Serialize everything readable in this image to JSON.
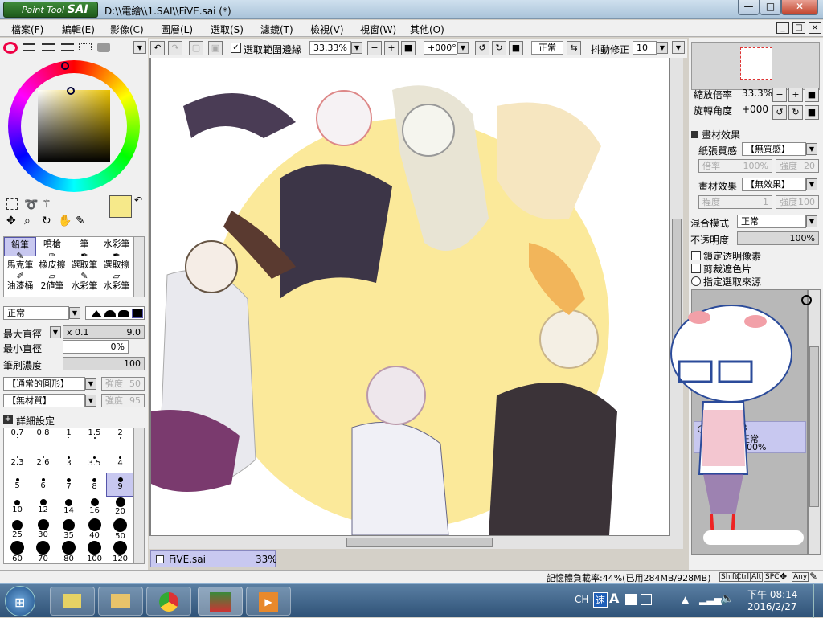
{
  "titlebar": {
    "logo_small": "Paint Tool",
    "logo_big": "SAI",
    "title": "D:\\\\電繪\\\\1.SAI\\\\FiVE.sai (*)",
    "btn_min": "—",
    "btn_max": "□",
    "btn_close": "✕"
  },
  "menu": [
    "檔案(F)",
    "編輯(E)",
    "影像(C)",
    "圖層(L)",
    "選取(S)",
    "濾鏡(T)",
    "檢視(V)",
    "視窗(W)",
    "其他(O)"
  ],
  "toolbar": {
    "selection_edge_label": "選取範圍邊緣",
    "zoom": "33.33%",
    "rotation": "+000°",
    "mode": "正常",
    "stabilizer_label": "抖動修正",
    "stabilizer_value": "10"
  },
  "tools": {
    "row1": [
      "鉛筆",
      "噴槍",
      "筆",
      "水彩筆"
    ],
    "row2": [
      "馬克筆",
      "橡皮擦",
      "選取筆",
      "選取擦"
    ],
    "row3": [
      "油漆桶",
      "2値筆",
      "水彩筆",
      "水彩筆"
    ]
  },
  "brush": {
    "blend": "正常",
    "max_size_label": "最大直徑",
    "max_size_mult": "x 0.1",
    "max_size_val": "9.0",
    "min_size_label": "最小直徑",
    "min_size_val": "0%",
    "density_label": "筆刷濃度",
    "density_val": "100",
    "shape": "【通常的圓形】",
    "shape_strength_label": "強度",
    "shape_strength": "50",
    "texture": "【無材質】",
    "texture_strength_label": "強度",
    "texture_strength": "95",
    "details": "詳細設定"
  },
  "brush_sizes": [
    {
      "l": "0.7",
      "d": 1
    },
    {
      "l": "0.8",
      "d": 1
    },
    {
      "l": "1",
      "d": 1
    },
    {
      "l": "1.5",
      "d": 2
    },
    {
      "l": "2",
      "d": 2
    },
    {
      "l": "2.3",
      "d": 2
    },
    {
      "l": "2.6",
      "d": 2
    },
    {
      "l": "3",
      "d": 3
    },
    {
      "l": "3.5",
      "d": 3
    },
    {
      "l": "4",
      "d": 3
    },
    {
      "l": "5",
      "d": 4
    },
    {
      "l": "6",
      "d": 4
    },
    {
      "l": "7",
      "d": 5
    },
    {
      "l": "8",
      "d": 5
    },
    {
      "l": "9",
      "d": 6
    },
    {
      "l": "10",
      "d": 7
    },
    {
      "l": "12",
      "d": 8
    },
    {
      "l": "14",
      "d": 9
    },
    {
      "l": "16",
      "d": 10
    },
    {
      "l": "20",
      "d": 12
    },
    {
      "l": "25",
      "d": 13
    },
    {
      "l": "30",
      "d": 14
    },
    {
      "l": "35",
      "d": 15
    },
    {
      "l": "40",
      "d": 16
    },
    {
      "l": "50",
      "d": 17
    },
    {
      "l": "60",
      "d": 17
    },
    {
      "l": "70",
      "d": 17
    },
    {
      "l": "80",
      "d": 17
    },
    {
      "l": "100",
      "d": 17
    },
    {
      "l": "120",
      "d": 17
    }
  ],
  "selected_brush_size": "9",
  "navigator": {
    "zoom_label": "縮放倍率",
    "zoom_val": "33.3%",
    "rot_label": "旋轉角度",
    "rot_val": "+000"
  },
  "effects": {
    "header": "畫材效果",
    "paper_label": "紙張質感",
    "paper_val": "【無質感】",
    "scale_label": "倍率",
    "scale_val": "100%",
    "strength_label": "強度",
    "strength_val": "20",
    "effect_label": "畫材效果",
    "effect_val": "【無效果】",
    "degree_label": "程度",
    "degree_val": "1",
    "strength2_label": "強度",
    "strength2_val": "100"
  },
  "layer_props": {
    "blend_label": "混合模式",
    "blend_val": "正常",
    "opacity_label": "不透明度",
    "opacity_val": "100%",
    "lock_alpha": "鎖定透明像素",
    "clip": "剪裁遮色片",
    "selection_source": "指定選取來源"
  },
  "layer": {
    "name": "B",
    "mode": "正常",
    "opacity": "100%"
  },
  "doc_tab": {
    "name": "FiVE.sai",
    "zoom": "33%"
  },
  "status": {
    "memory": "記憶體負載率:44%(已用284MB/928MB)",
    "keys": [
      "Shift",
      "Ctrl",
      "Alt",
      "SPC",
      "Any"
    ]
  },
  "taskbar": {
    "ime": "CH",
    "ime2": "速",
    "time": "下午 08:14",
    "date": "2016/2/27"
  },
  "colors": {
    "primary": "#f6e98a",
    "accent_select": "#c8c8f0",
    "canvas_bg": "#808080"
  }
}
